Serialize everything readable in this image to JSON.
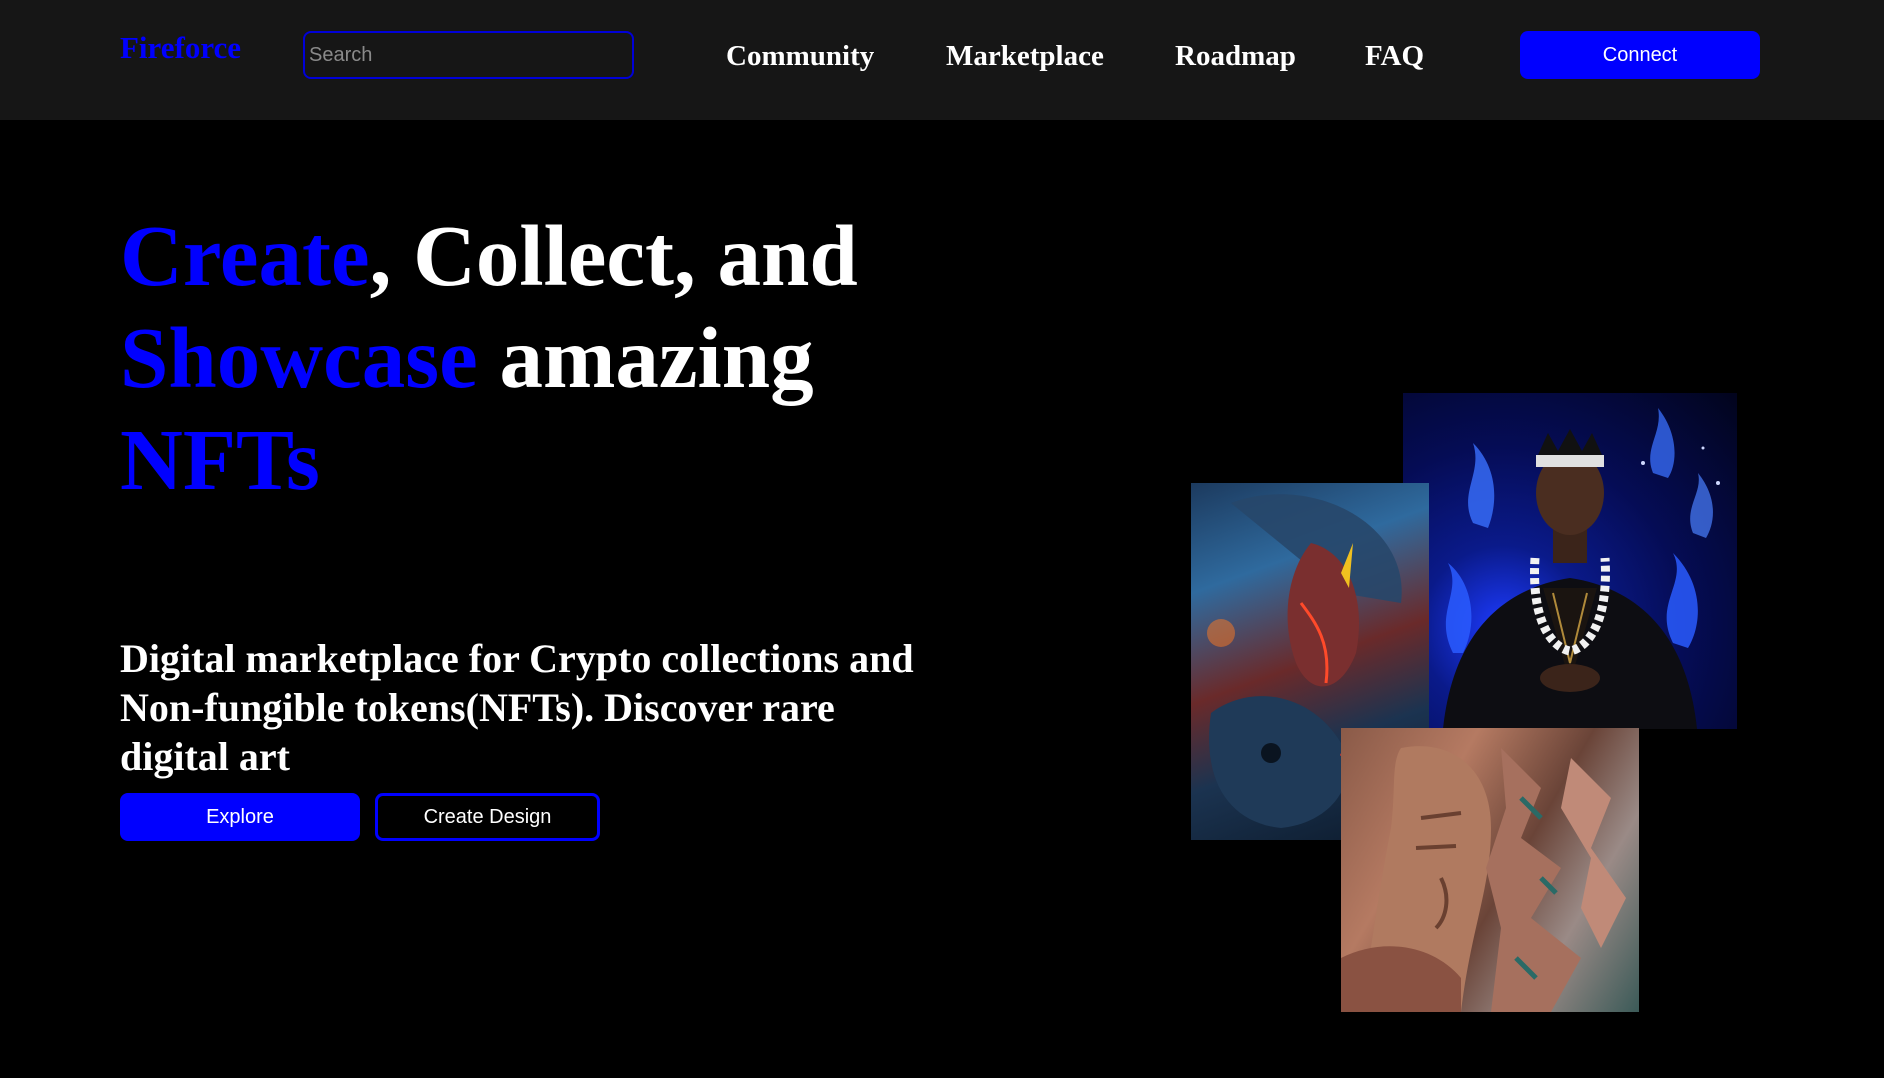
{
  "nav": {
    "logo": "Fireforce",
    "search_placeholder": "Search",
    "links": [
      "Community",
      "Marketplace",
      "Roadmap",
      "FAQ"
    ],
    "connect_label": "Connect"
  },
  "hero": {
    "headline": {
      "word1": "Create",
      "rest1": ", Collect, and",
      "word2": "Showcase",
      "rest2": " amazing",
      "word3": "NFTs"
    },
    "subtext": "Digital marketplace for Crypto collections and Non-fungible tokens(NFTs). Discover rare digital art",
    "explore_label": "Explore",
    "create_label": "Create Design"
  },
  "colors": {
    "accent": "#0000ff",
    "navbar_bg": "#161616",
    "page_bg": "#000000",
    "text": "#ffffff"
  }
}
